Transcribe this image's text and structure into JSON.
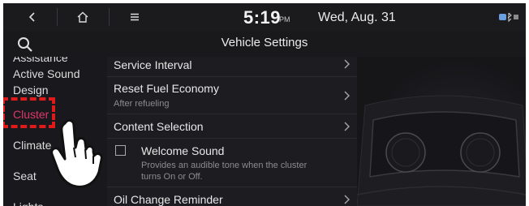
{
  "status_bar": {
    "back_icon": "chevron-left-icon",
    "home_icon": "home-icon",
    "menu_icon": "menu-icon",
    "time": "5:19",
    "ampm": "PM",
    "date": "Wed, Aug. 31",
    "system_icon": "bluetooth-battery-icon"
  },
  "title_bar": {
    "search_icon": "search-icon",
    "title": "Vehicle Settings"
  },
  "sidebar": {
    "items": [
      {
        "label": "Assistance",
        "partial": true
      },
      {
        "label": "Active Sound"
      },
      {
        "label": "Design"
      },
      {
        "label": "Cluster",
        "selected": true
      },
      {
        "label": "Climate"
      },
      {
        "label": "Seat"
      },
      {
        "label": "Lights",
        "partial": true
      }
    ]
  },
  "settings_list": {
    "rows": [
      {
        "title": "Service Interval",
        "chevron": true
      },
      {
        "title": "Reset Fuel Economy",
        "subtitle": "After refueling",
        "chevron": true
      },
      {
        "title": "Content Selection",
        "chevron": true
      },
      {
        "title": "Welcome Sound",
        "subtitle_line1": "Provides an audible tone when the cluster",
        "subtitle_line2": "turns On or Off.",
        "checkbox": true,
        "checked": false
      },
      {
        "title": "Oil Change Reminder",
        "chevron": true
      }
    ]
  },
  "annotation": {
    "highlight_color": "#e01a1a",
    "pointer": "hand-pointer-icon"
  },
  "colors": {
    "accent": "#e0366a",
    "background": "#141316"
  }
}
